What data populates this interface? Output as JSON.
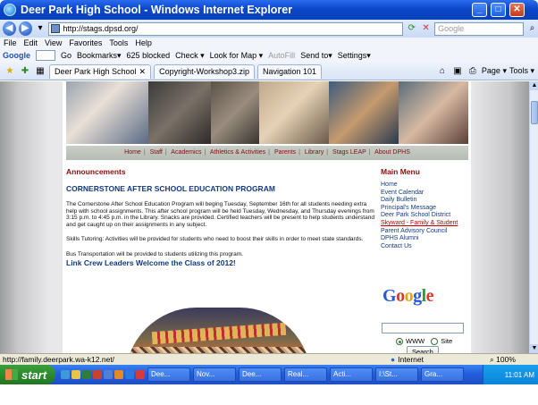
{
  "window": {
    "title": "Deer Park High School - Windows Internet Explorer"
  },
  "address": {
    "url": "http://stags.dpsd.org/",
    "search_placeholder": "Google"
  },
  "menubar": [
    "File",
    "Edit",
    "View",
    "Favorites",
    "Tools",
    "Help"
  ],
  "googlebar": {
    "label": "Google",
    "go_label": "Go",
    "items": [
      "Bookmarks▾",
      "625 blocked",
      "Check ▾",
      "Look for Map ▾",
      "AutoFill",
      "Send to▾",
      "Settings▾"
    ]
  },
  "tabs": [
    {
      "label": "Deer Park High School",
      "active": true
    },
    {
      "label": "Copyright-Workshop3.zip",
      "active": false
    },
    {
      "label": "Navigation 101",
      "active": false
    }
  ],
  "tab_tools": [
    "Page ▾",
    "Tools ▾"
  ],
  "site": {
    "nav": [
      "Home",
      "Staff",
      "Academics",
      "Athletics & Activities",
      "Parents",
      "Library",
      "Stags LEAP",
      "About DPHS"
    ],
    "announcements_heading": "Announcements",
    "article_title": "CORNERSTONE AFTER SCHOOL EDUCATION PROGRAM",
    "paragraphs": [
      "The Cornerstone After School Education Program will beging Tuesday, September 16th for all students needing extra help with school assignments.  This after school program will be held Tuesday, Wednesday, and Thursday evenings from 3:15 p.m. to 4:45 p.m. in the Library.  Snacks are provided.  Certified teachers will be present to help students understand and get caught up on their assignments in any subject.",
      "Skills Tutoring:  Activities will be provided for students who need to boost their skills in order to meet state standards.",
      "Bus Transportation will be provided to students utilizing this program."
    ],
    "second_title": "Link Crew Leaders Welcome the Class of 2012!",
    "main_menu_heading": "Main Menu",
    "main_menu": [
      "Home",
      "Event Calendar",
      "Daily Bulletin",
      "Principal's Message",
      "Deer Park School District",
      "Skyward - Family & Student",
      "Parent Advisory Council",
      "DPHS Alumni",
      "Contact Us"
    ],
    "google_logo": "Google",
    "search_options": [
      "WWW",
      "Site"
    ],
    "search_button": "Search"
  },
  "status": {
    "text": "http://family.deerpark.wa-k12.net/",
    "zone": "Internet",
    "zoom": "100%"
  },
  "taskbar": {
    "start": "start",
    "buttons": [
      "Dee...",
      "Nov...",
      "Dee...",
      "Real...",
      "Acti...",
      "I:\\St...",
      "Gra..."
    ],
    "clock": "11:01 AM"
  }
}
